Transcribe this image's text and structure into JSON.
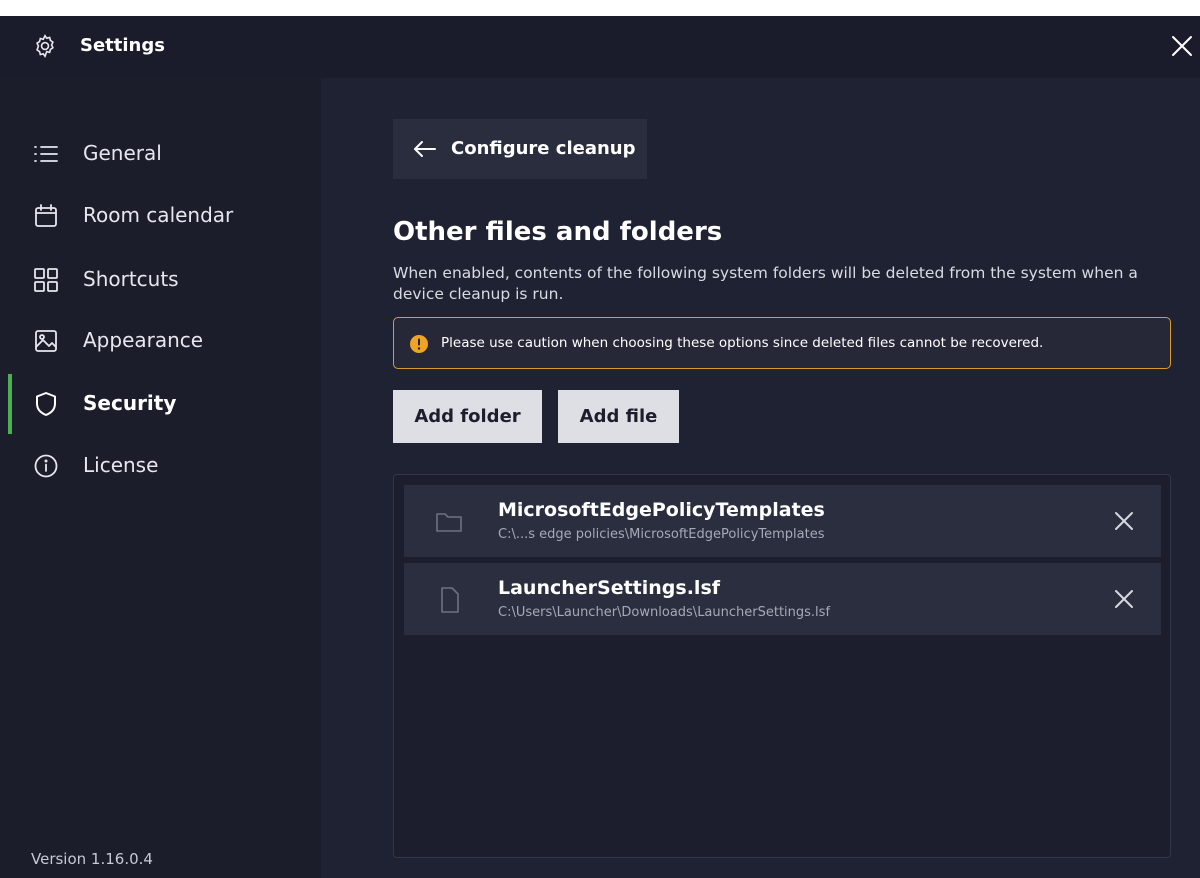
{
  "window": {
    "title": "Settings"
  },
  "sidebar": {
    "items": [
      {
        "label": "General",
        "icon": "list-icon"
      },
      {
        "label": "Room calendar",
        "icon": "calendar-icon"
      },
      {
        "label": "Shortcuts",
        "icon": "grid-icon"
      },
      {
        "label": "Appearance",
        "icon": "image-icon"
      },
      {
        "label": "Security",
        "icon": "shield-icon",
        "active": true
      },
      {
        "label": "License",
        "icon": "info-icon"
      }
    ],
    "version": "Version 1.16.0.4"
  },
  "main": {
    "back_label": "Configure cleanup",
    "title": "Other files and folders",
    "description": "When enabled, contents of the following system folders will be deleted from the system when a device cleanup is run.",
    "warning": "Please use caution when choosing these options since deleted files cannot be recovered.",
    "add_folder_label": "Add folder",
    "add_file_label": "Add file",
    "items": [
      {
        "name": "MicrosoftEdgePolicyTemplates",
        "path": "C:\\...s edge policies\\MicrosoftEdgePolicyTemplates",
        "icon": "folder-icon"
      },
      {
        "name": "LauncherSettings.lsf",
        "path": "C:\\Users\\Launcher\\Downloads\\LauncherSettings.lsf",
        "icon": "file-icon"
      }
    ]
  },
  "colors": {
    "background": "#1f2233",
    "sidebar": "#1b1d2b",
    "active_indicator": "#4caf50",
    "warning_border": "#d89a2e"
  }
}
